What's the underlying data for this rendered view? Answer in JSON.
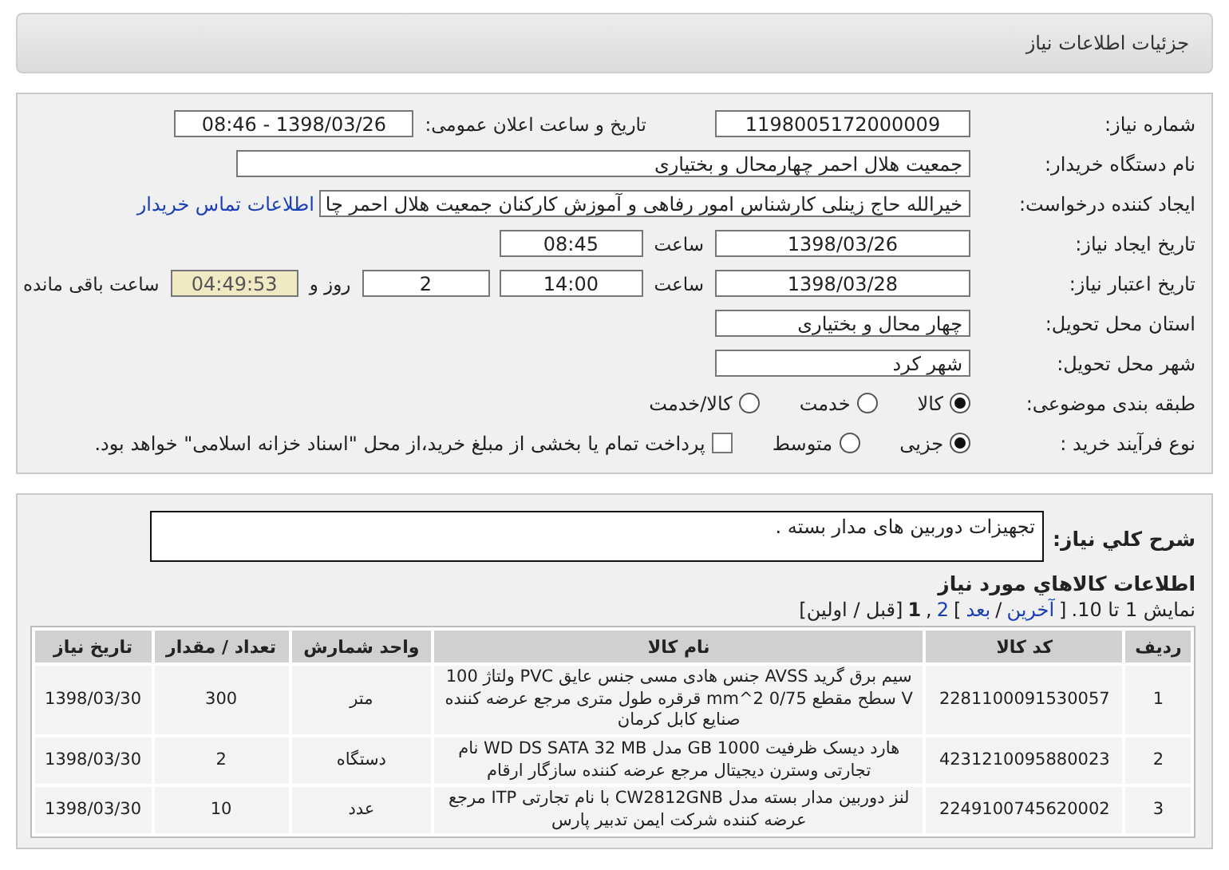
{
  "header": {
    "title": "جزئیات اطلاعات نیاز"
  },
  "form": {
    "need_number": {
      "label": "شماره نیاز:",
      "value": "1198005172000009"
    },
    "announce": {
      "label": "تاریخ و ساعت اعلان عمومی:",
      "value": "1398/03/26 - 08:46"
    },
    "buyer": {
      "label": "نام دستگاه خریدار:",
      "value": "جمعیت هلال احمر چهارمحال و بختیاری"
    },
    "requester": {
      "label": "ایجاد کننده درخواست:",
      "value": "خیرالله حاج زینلی کارشناس امور رفاهی و آموزش کارکنان جمعیت هلال احمر چا",
      "link": "اطلاعات تماس خریدار"
    },
    "created": {
      "label": "تاریخ ایجاد نیاز:",
      "value": "1398/03/26",
      "time_label": "ساعت",
      "time": "08:45"
    },
    "validity": {
      "label": "تاریخ اعتبار نیاز:",
      "value": "1398/03/28",
      "time_label": "ساعت",
      "time": "14:00",
      "days": "2",
      "days_label": "روز و",
      "remaining": "04:49:53",
      "remaining_label": "ساعت باقی مانده"
    },
    "province": {
      "label": "استان محل تحویل:",
      "value": "چهار محال و بختیاری"
    },
    "city": {
      "label": "شهر محل تحویل:",
      "value": "شهر کرد"
    },
    "category": {
      "label": "طبقه بندی موضوعی:",
      "options": [
        {
          "label": "کالا",
          "selected": true
        },
        {
          "label": "خدمت",
          "selected": false
        },
        {
          "label": "کالا/خدمت",
          "selected": false
        }
      ]
    },
    "process": {
      "label": "نوع فرآیند خرید :",
      "options": [
        {
          "label": "جزیی",
          "selected": true
        },
        {
          "label": "متوسط",
          "selected": false
        }
      ],
      "payment": {
        "checked": false,
        "text": "پرداخت تمام یا بخشی از مبلغ خرید،از محل \"اسناد خزانه اسلامی\" خواهد بود."
      }
    }
  },
  "description": {
    "label": "شرح کلي نياز:",
    "value": "تجهیزات دوربین های مدار بسته ."
  },
  "items": {
    "title": "اطلاعات کالاهاي مورد نياز",
    "pagination": [
      {
        "kind": "text",
        "text": "نمایش 1 تا 10."
      },
      {
        "kind": "text",
        "text": "["
      },
      {
        "kind": "link",
        "text": "آخرین"
      },
      {
        "kind": "text",
        "text": "/"
      },
      {
        "kind": "link",
        "text": "بعد"
      },
      {
        "kind": "text",
        "text": "]"
      },
      {
        "kind": "link",
        "text": "2"
      },
      {
        "kind": "text",
        "text": ","
      },
      {
        "kind": "current",
        "text": "1"
      },
      {
        "kind": "text",
        "text": "[قبل / اولین]"
      }
    ],
    "columns": [
      "ردیف",
      "کد کالا",
      "نام کالا",
      "واحد شمارش",
      "تعداد / مقدار",
      "تاریخ نیاز"
    ],
    "rows": [
      [
        "1",
        "2281100091530057",
        "سیم برق گرید AVSS جنس هادی مسی جنس عایق PVC ولتاژ 100 V سطح مقطع 0/75 mm^2 قرقره طول متری مرجع عرضه کننده صنایع کابل کرمان",
        "متر",
        "300",
        "1398/03/30"
      ],
      [
        "2",
        "4231210095880023",
        "هارد دیسک ظرفیت 1000 GB مدل WD DS SATA 32 MB نام تجارتی وسترن دیجیتال مرجع عرضه کننده سازگار ارقام",
        "دستگاه",
        "2",
        "1398/03/30"
      ],
      [
        "3",
        "2249100745620002",
        "لنز دوربین مدار بسته مدل CW2812GNB با نام تجارتی ITP مرجع عرضه کننده شرکت ایمن تدبیر پارس",
        "عدد",
        "10",
        "1398/03/30"
      ]
    ]
  }
}
